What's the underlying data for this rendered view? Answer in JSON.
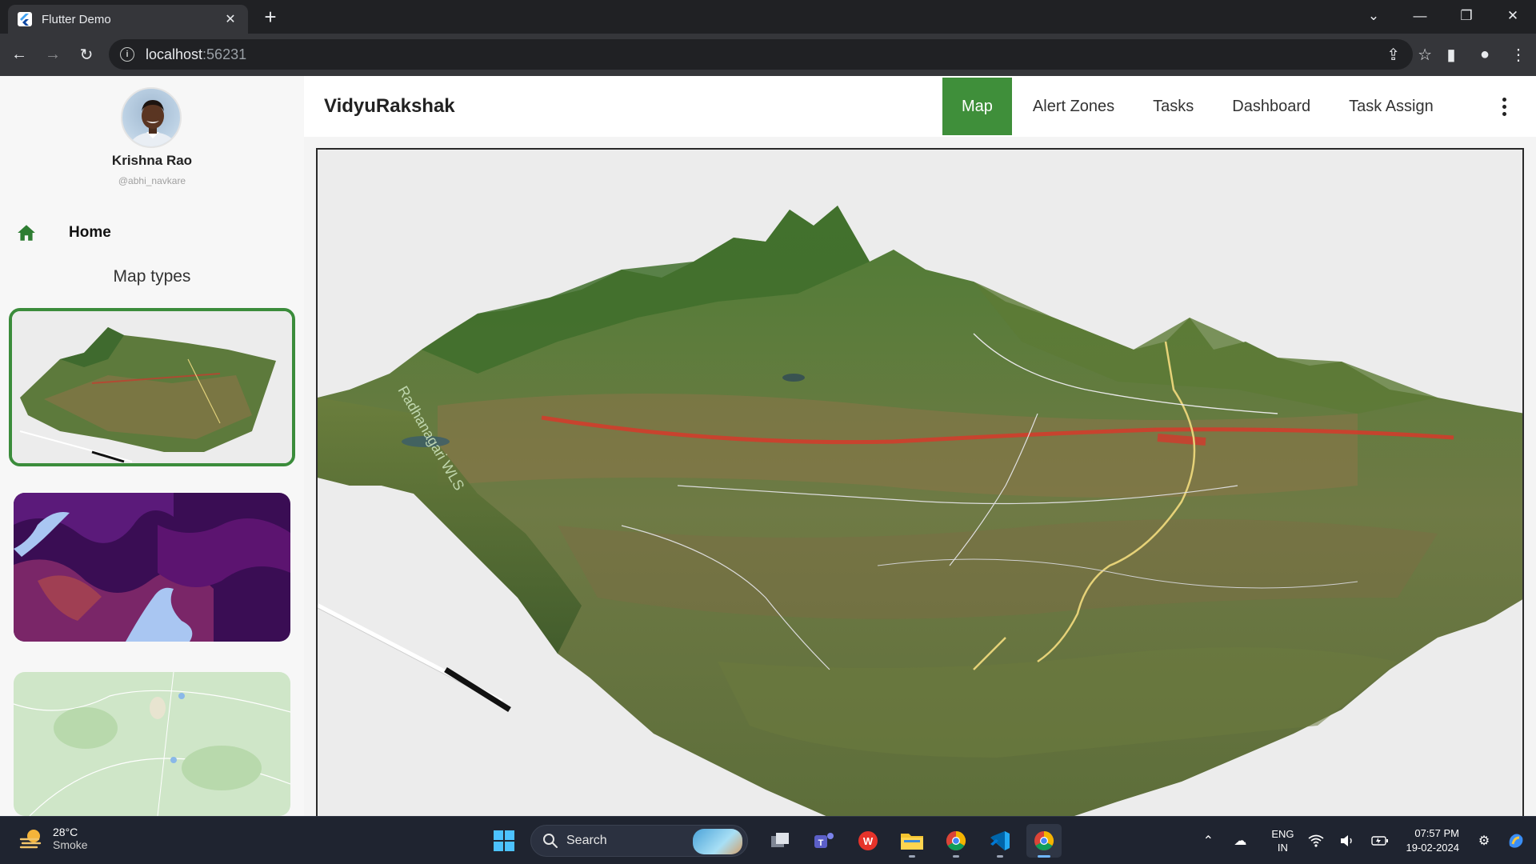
{
  "browser": {
    "tab_title": "Flutter Demo",
    "tab_close": "✕",
    "new_tab": "+",
    "url_host": "localhost",
    "url_port": ":56231"
  },
  "drawer": {
    "user_name": "Krishna Rao",
    "user_handle": "@abhi_navkare",
    "home_label": "Home",
    "map_types_title": "Map types",
    "map_types": [
      {
        "name": "3D terrain",
        "selected": true
      },
      {
        "name": "heatmap",
        "selected": false
      },
      {
        "name": "street map",
        "selected": false
      }
    ]
  },
  "appbar": {
    "title": "VidyuRakshak",
    "tabs": [
      {
        "label": "Map",
        "active": true
      },
      {
        "label": "Alert Zones",
        "active": false
      },
      {
        "label": "Tasks",
        "active": false
      },
      {
        "label": "Dashboard",
        "active": false
      },
      {
        "label": "Task Assign",
        "active": false
      }
    ]
  },
  "taskbar": {
    "weather_temp": "28°C",
    "weather_cond": "Smoke",
    "search_label": "Search",
    "lang_top": "ENG",
    "lang_bottom": "IN",
    "time": "07:57 PM",
    "date": "19-02-2024"
  },
  "colors": {
    "accent_green": "#3f8f3a",
    "browser_dark": "#202124",
    "taskbar": "#1f2430"
  }
}
